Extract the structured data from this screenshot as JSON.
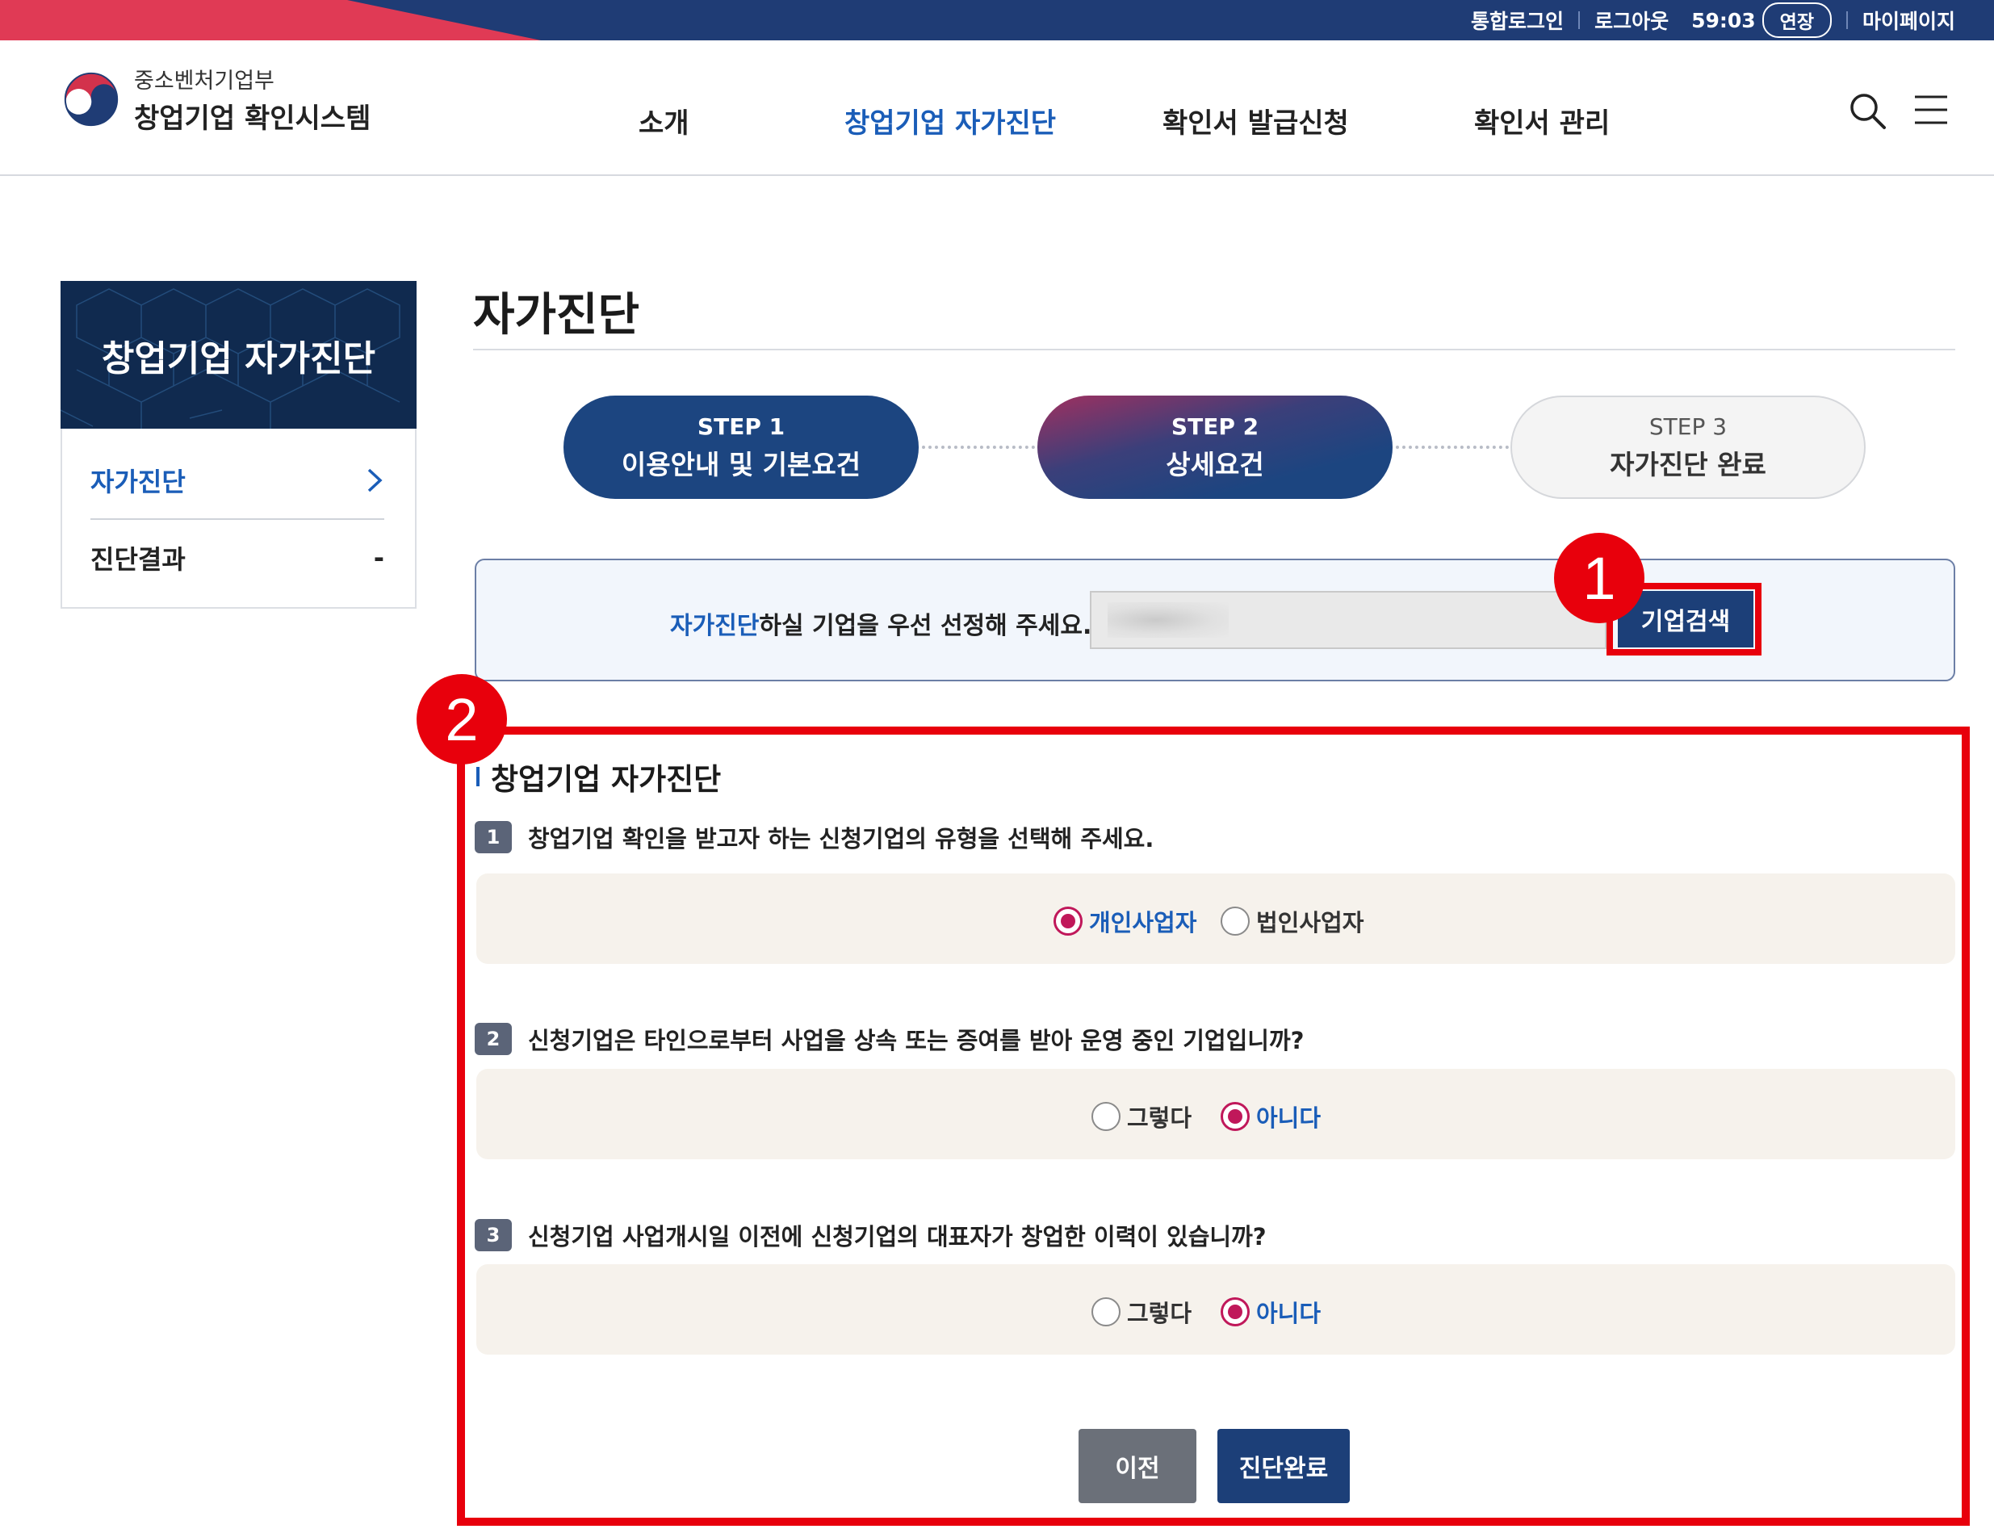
{
  "topbar": {
    "integrated_login": "통합로그인",
    "logout": "로그아웃",
    "timer": "59:03",
    "extend": "연장",
    "mypage": "마이페이지"
  },
  "header": {
    "ministry": "중소벤처기업부",
    "system_name": "창업기업 확인시스템",
    "nav": [
      {
        "label": "소개"
      },
      {
        "label": "창업기업 자가진단"
      },
      {
        "label": "확인서 발급신청"
      },
      {
        "label": "확인서 관리"
      }
    ]
  },
  "sidebar": {
    "title": "창업기업 자가진단",
    "items": [
      {
        "label": "자가진단",
        "mark": "›"
      },
      {
        "label": "진단결과",
        "mark": "-"
      }
    ]
  },
  "main": {
    "title": "자가진단",
    "steps": [
      {
        "num": "STEP 1",
        "name": "이용안내 및 기본요건"
      },
      {
        "num": "STEP 2",
        "name": "상세요건"
      },
      {
        "num": "STEP 3",
        "name": "자가진단 완료"
      }
    ],
    "company_select": {
      "highlight": "자가진단",
      "rest": "하실 기업을 우선 선정해 주세요.",
      "search_button": "기업검색"
    },
    "section_title": "창업기업 자가진단",
    "questions": [
      {
        "num": "1",
        "text": "창업기업 확인을 받고자 하는 신청기업의 유형을 선택해 주세요.",
        "options": [
          {
            "label": "개인사업자",
            "selected": true
          },
          {
            "label": "법인사업자",
            "selected": false
          }
        ]
      },
      {
        "num": "2",
        "text": "신청기업은 타인으로부터 사업을 상속 또는 증여를 받아 운영 중인 기업입니까?",
        "options": [
          {
            "label": "그렇다",
            "selected": false
          },
          {
            "label": "아니다",
            "selected": true
          }
        ]
      },
      {
        "num": "3",
        "text": "신청기업 사업개시일 이전에 신청기업의 대표자가 창업한 이력이 있습니까?",
        "options": [
          {
            "label": "그렇다",
            "selected": false
          },
          {
            "label": "아니다",
            "selected": true
          }
        ]
      }
    ],
    "buttons": {
      "prev": "이전",
      "complete": "진단완료"
    }
  },
  "annotations": {
    "badge1": "1",
    "badge2": "2"
  },
  "colors": {
    "navy": "#1f3c75",
    "accent_red": "#e03a55",
    "link_blue": "#1a5db8",
    "radio_selected": "#c0185a",
    "highlight_red": "#e8000c"
  }
}
